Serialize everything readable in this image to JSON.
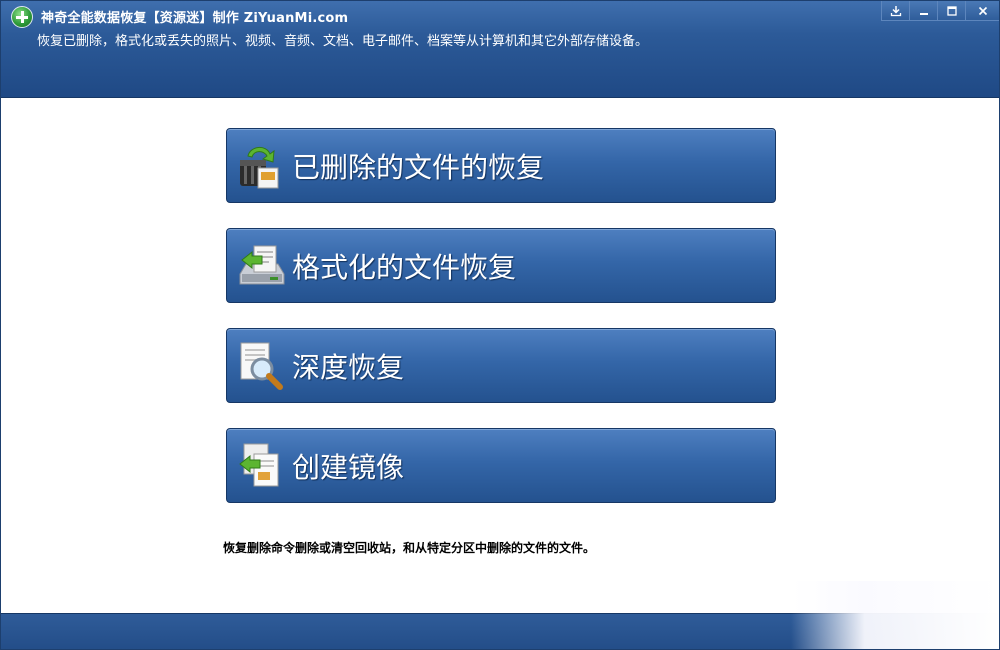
{
  "window": {
    "title": "神奇全能数据恢复【资源迷】制作 ZiYuanMi.com",
    "subtitle": "恢复已删除，格式化或丢失的照片、视频、音频、文档、电子邮件、档案等从计算机和其它外部存储设备。",
    "controls": {
      "download": "download-icon",
      "minimize": "minimize-icon",
      "maximize": "maximize-icon",
      "close": "close-icon"
    }
  },
  "actions": [
    {
      "label": "已删除的文件的恢复",
      "icon": "deleted-file-recovery-icon"
    },
    {
      "label": "格式化的文件恢复",
      "icon": "formatted-drive-recovery-icon"
    },
    {
      "label": "深度恢复",
      "icon": "deep-scan-magnifier-icon"
    },
    {
      "label": "创建镜像",
      "icon": "create-image-icon"
    }
  ],
  "description": "恢复删除命令删除或清空回收站，和从特定分区中删除的文件的文件。",
  "colors": {
    "header": "#2c5a98",
    "button": "#3466a8",
    "footer": "#234d88"
  }
}
